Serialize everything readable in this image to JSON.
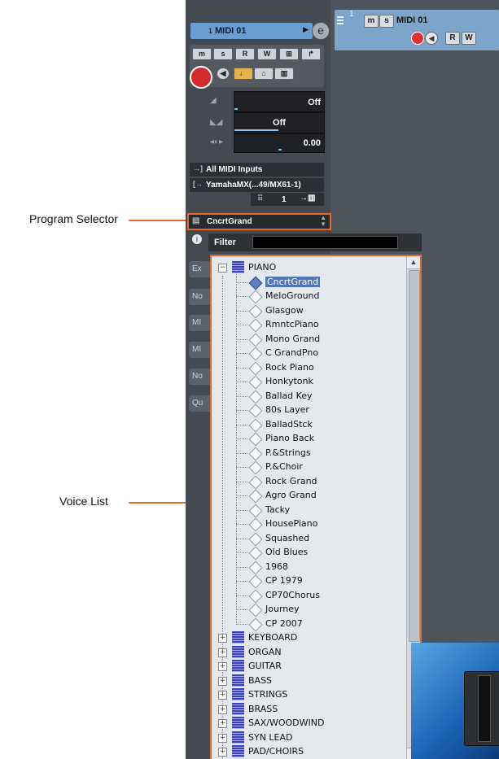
{
  "annotations": {
    "program_selector": "Program Selector",
    "voice_list": "Voice List"
  },
  "track_header": {
    "number": "1",
    "mute": "m",
    "solo": "s",
    "name": "MIDI 01",
    "read": "R",
    "write": "W"
  },
  "inspector": {
    "track_number": "1",
    "track_name": "MIDI 01",
    "buttons": [
      "m",
      "s",
      "R",
      "W"
    ],
    "volume_value": "Off",
    "pan_value": "Off",
    "delay_value": "0.00",
    "midi_input": "All MIDI Inputs",
    "midi_output": "YamahaMX(...49/MX61-1)",
    "channel": "1",
    "program": "CncrtGrand",
    "side_tabs": [
      "Ex",
      "No",
      "MI",
      "MI",
      "No",
      "Qu"
    ]
  },
  "voice_popup": {
    "filter_label": "Filter",
    "filter_value": "",
    "selected_voice": "CncrtGrand",
    "categories_expanded": "PIANO",
    "piano_voices": [
      "CncrtGrand",
      "MeloGround",
      "Glasgow",
      "RmntcPiano",
      "Mono Grand",
      "C GrandPno",
      "Rock Piano",
      "Honkytonk",
      "Ballad Key",
      "80s Layer",
      "BalladStck",
      "Piano Back",
      "P.&Strings",
      "P.&Choir",
      "Rock Grand",
      "Agro Grand",
      "Tacky",
      "HousePiano",
      "Squashed",
      "Old Blues",
      "1968",
      "CP 1979",
      "CP70Chorus",
      "Journey",
      "CP 2007"
    ],
    "collapsed_categories": [
      "KEYBOARD",
      "ORGAN",
      "GUITAR",
      "BASS",
      "STRINGS",
      "BRASS",
      "SAX/WOODWIND",
      "SYN LEAD",
      "PAD/CHOIRS"
    ]
  },
  "colors": {
    "annotation": "#e26a2c",
    "track_header": "#7da5c9",
    "selection": "#5077b7",
    "category_icon": "#3b3fc9"
  }
}
